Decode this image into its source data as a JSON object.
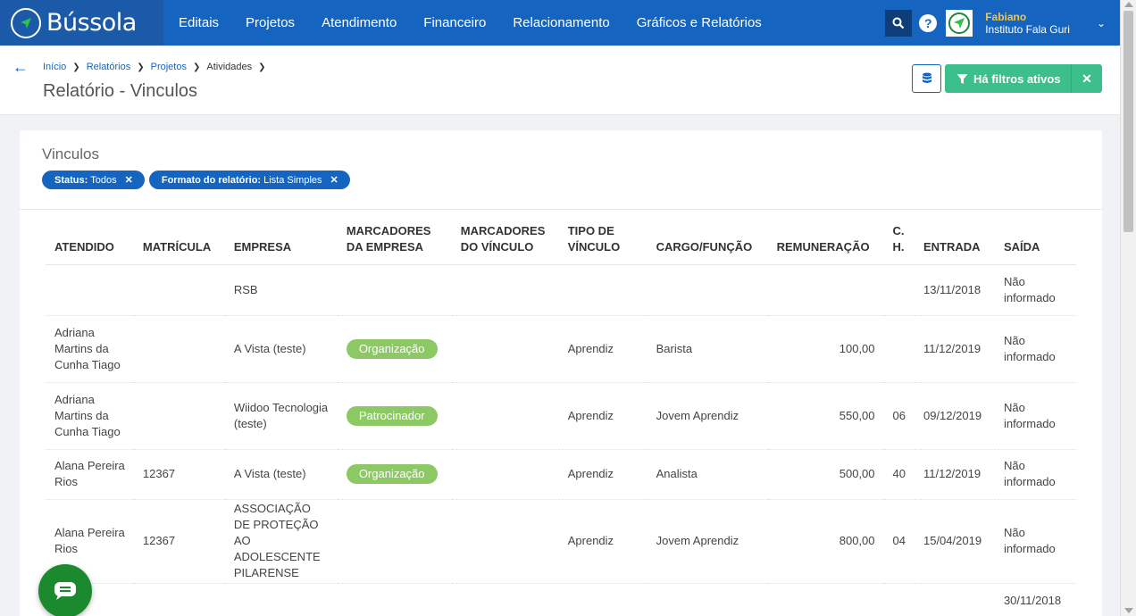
{
  "app": {
    "name": "Bússola"
  },
  "nav": {
    "items": [
      "Editais",
      "Projetos",
      "Atendimento",
      "Financeiro",
      "Relacionamento",
      "Gráficos e Relatórios"
    ]
  },
  "user": {
    "name": "Fabiano",
    "org": "Instituto Fala Guri"
  },
  "breadcrumb": [
    "Início",
    "Relatórios",
    "Projetos",
    "Atividades"
  ],
  "page": {
    "title": "Relatório - Vinculos"
  },
  "actions": {
    "filter_label": "Há filtros ativos"
  },
  "card": {
    "title": "Vinculos",
    "chips": [
      {
        "key": "Status:",
        "value": "Todos"
      },
      {
        "key": "Formato do relatório:",
        "value": "Lista Simples"
      }
    ]
  },
  "table": {
    "headers": {
      "atendido": "ATENDIDO",
      "matricula": "MATRÍCULA",
      "empresa": "EMPRESA",
      "marc_empresa": "MARCADORES DA EMPRESA",
      "marc_vinculo": "MARCADORES DO VÍNCULO",
      "tipo": "TIPO DE VÍNCULO",
      "cargo": "CARGO/FUNÇÃO",
      "remuneracao": "REMUNERAÇÃO",
      "ch": "C. H.",
      "entrada": "ENTRADA",
      "saida": "SAÍDA"
    },
    "rows": [
      {
        "atendido": "",
        "matricula": "",
        "empresa": "RSB",
        "marc_empresa": "",
        "marc_vinculo": "",
        "tipo": "",
        "cargo": "",
        "remuneracao": "",
        "ch": "",
        "entrada": "13/11/2018",
        "saida": "Não informado"
      },
      {
        "atendido": "Adriana Martins da Cunha Tiago",
        "matricula": "",
        "empresa": "A Vista (teste)",
        "marc_empresa": "Organização",
        "marc_vinculo": "",
        "tipo": "Aprendiz",
        "cargo": "Barista",
        "remuneracao": "100,00",
        "ch": "",
        "entrada": "11/12/2019",
        "saida": "Não informado"
      },
      {
        "atendido": "Adriana Martins da Cunha Tiago",
        "matricula": "",
        "empresa": "Wiidoo Tecnologia (teste)",
        "marc_empresa": "Patrocinador",
        "marc_vinculo": "",
        "tipo": "Aprendiz",
        "cargo": "Jovem Aprendiz",
        "remuneracao": "550,00",
        "ch": "06",
        "entrada": "09/12/2019",
        "saida": "Não informado"
      },
      {
        "atendido": "Alana Pereira Rios",
        "matricula": "12367",
        "empresa": "A Vista (teste)",
        "marc_empresa": "Organização",
        "marc_vinculo": "",
        "tipo": "Aprendiz",
        "cargo": "Analista",
        "remuneracao": "500,00",
        "ch": "40",
        "entrada": "11/12/2019",
        "saida": "Não informado"
      },
      {
        "atendido": "Alana Pereira Rios",
        "matricula": "12367",
        "empresa": "ASSOCIAÇÃO DE PROTEÇÃO AO ADOLESCENTE PILARENSE",
        "marc_empresa": "",
        "marc_vinculo": "",
        "tipo": "Aprendiz",
        "cargo": "Jovem Aprendiz",
        "remuneracao": "800,00",
        "ch": "04",
        "entrada": "15/04/2019",
        "saida": "Não informado"
      },
      {
        "atendido": "",
        "matricula": "",
        "empresa": "",
        "marc_empresa": "",
        "marc_vinculo": "",
        "tipo": "",
        "cargo": "",
        "remuneracao": "",
        "ch": "",
        "entrada": "",
        "saida": "30/11/2018"
      }
    ]
  },
  "colors": {
    "primary": "#1565c0",
    "success": "#3cbf8a",
    "tag": "#8cc864",
    "chat": "#1b8a2e"
  }
}
